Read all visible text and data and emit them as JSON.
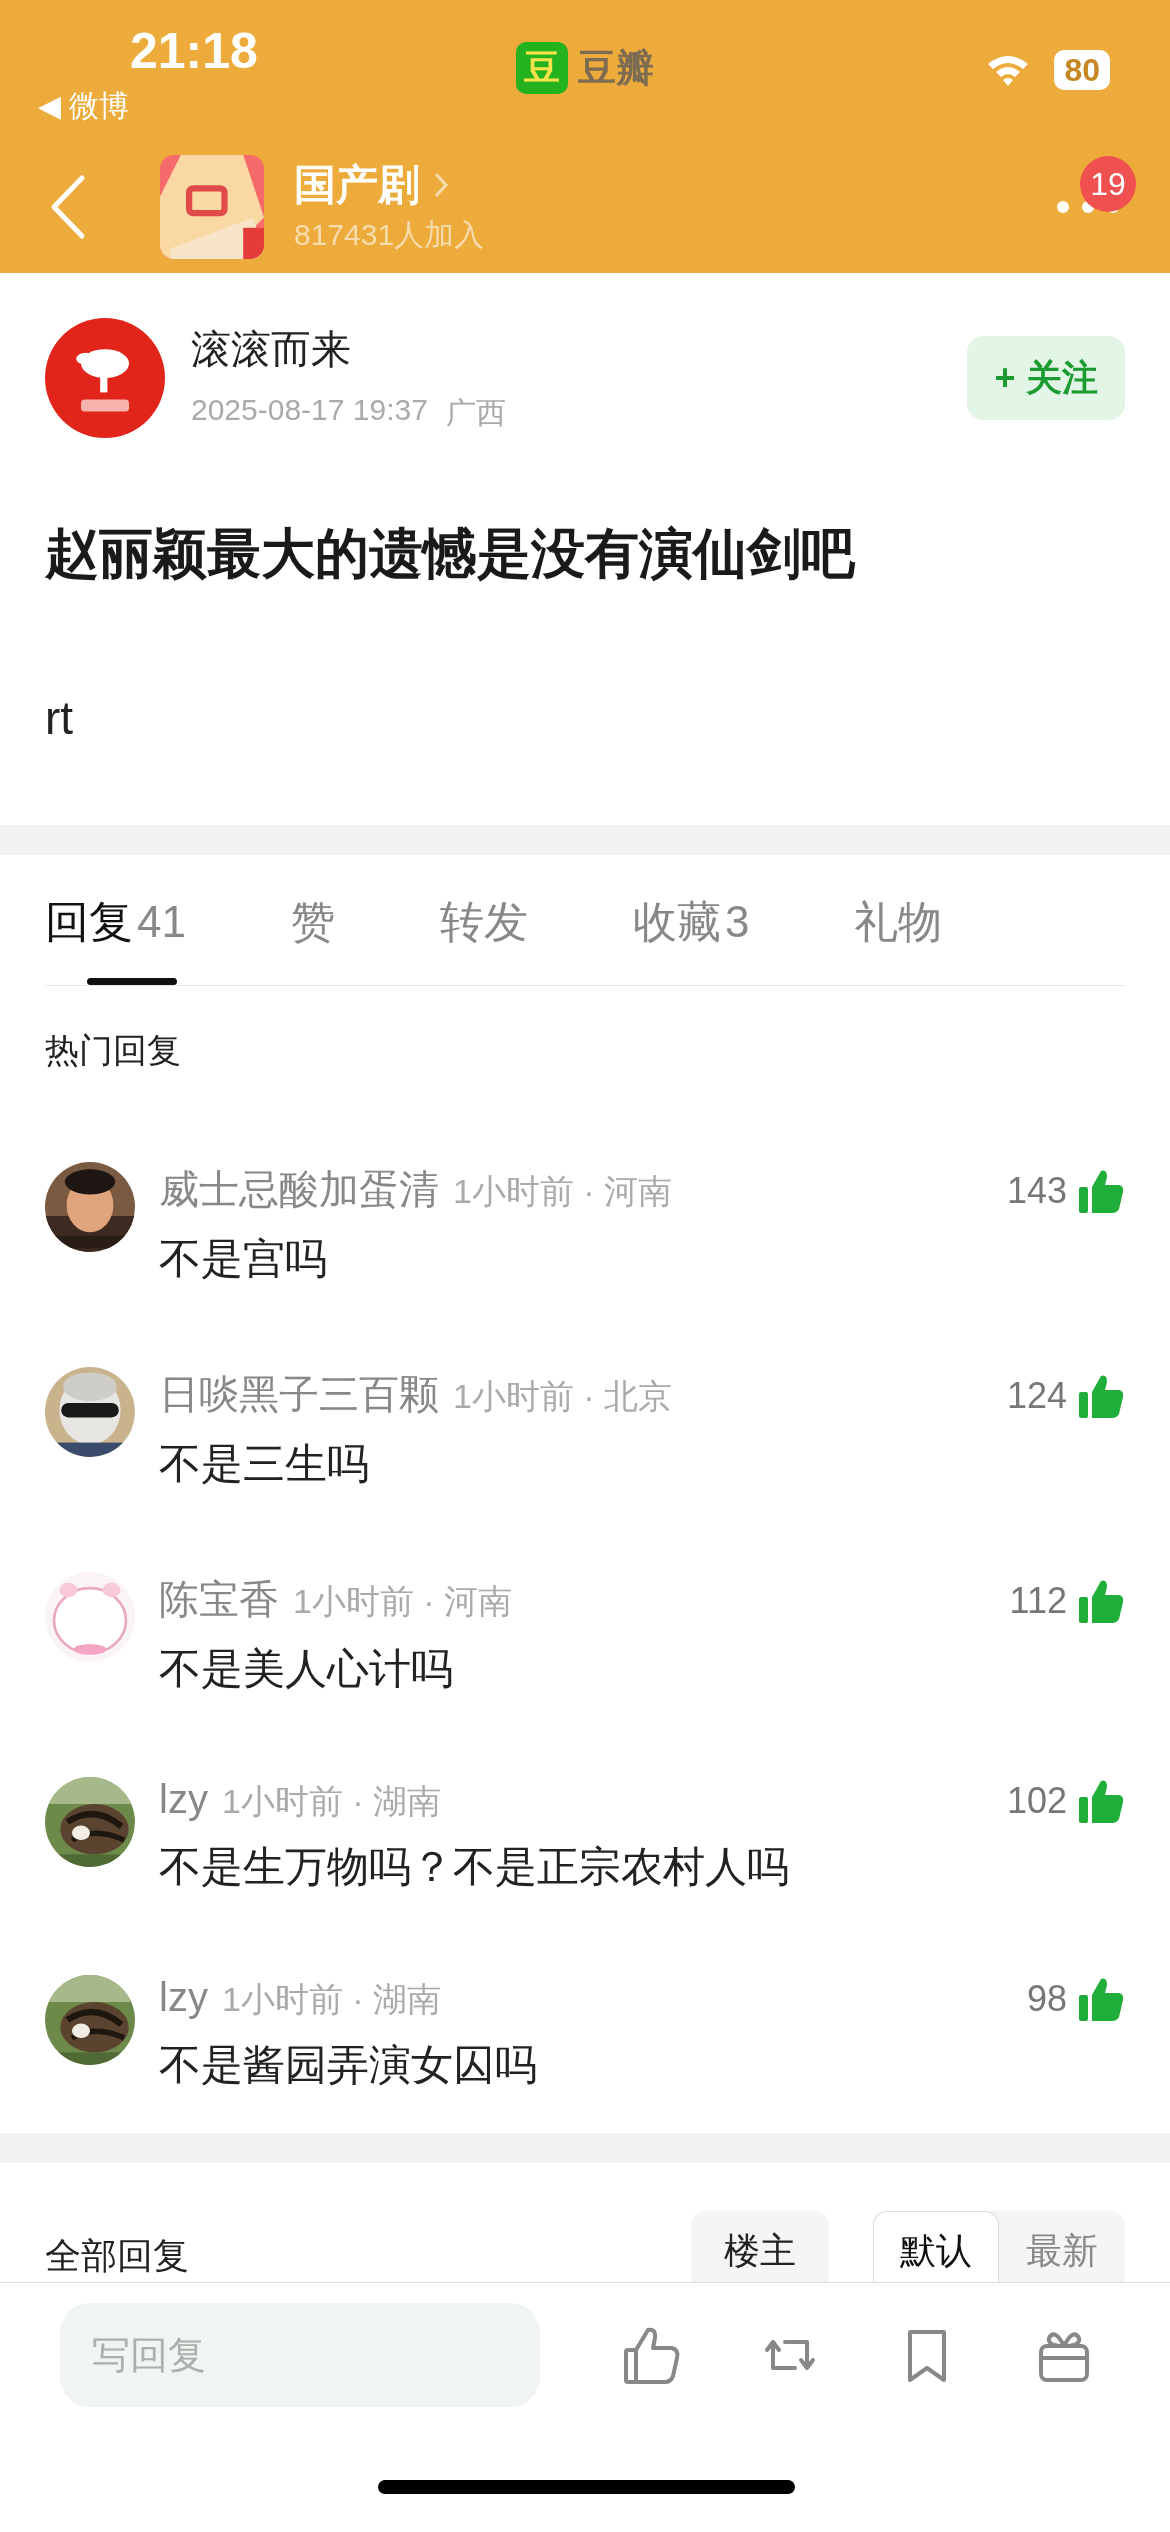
{
  "status_bar": {
    "time": "21:18",
    "back_app": "◀ 微博",
    "app_logo": "豆",
    "app_name": "豆瓣",
    "battery": "80"
  },
  "group_header": {
    "name": "国产剧",
    "members": "817431人加入",
    "badge": "19"
  },
  "post": {
    "author": "滚滚而来",
    "time": "2025-08-17 19:37",
    "location": "广西",
    "follow": "+ 关注",
    "title": "赵丽颖最大的遗憾是没有演仙剑吧",
    "body": "rt"
  },
  "tabs": [
    {
      "label": "回复",
      "count": "41",
      "selected": true
    },
    {
      "label": "赞",
      "selected": false
    },
    {
      "label": "转发",
      "selected": false
    },
    {
      "label": "收藏",
      "count": "3",
      "selected": false
    },
    {
      "label": "礼物",
      "selected": false
    }
  ],
  "hot_replies": {
    "title": "热门回复",
    "replies": [
      {
        "user": "威士忌酸加蛋清",
        "meta": "1小时前 · 河南",
        "likes": "143",
        "text": "不是宫吗"
      },
      {
        "user": "日啖黑子三百颗",
        "meta": "1小时前 · 北京",
        "likes": "124",
        "text": "不是三生吗"
      },
      {
        "user": "陈宝香",
        "meta": "1小时前 · 河南",
        "likes": "112",
        "text": "不是美人心计吗"
      },
      {
        "user": "lzy",
        "meta": "1小时前 · 湖南",
        "likes": "102",
        "text": "不是生万物吗？不是正宗农村人吗"
      },
      {
        "user": "lzy",
        "meta": "1小时前 · 湖南",
        "likes": "98",
        "text": "不是酱园弄演女囚吗"
      }
    ]
  },
  "all_replies": {
    "title": "全部回复",
    "filters": [
      {
        "label": "楼主",
        "selected": false
      }
    ],
    "sort": [
      {
        "label": "默认",
        "selected": true
      },
      {
        "label": "最新",
        "selected": false
      }
    ]
  },
  "bottom_bar": {
    "placeholder": "写回复"
  }
}
